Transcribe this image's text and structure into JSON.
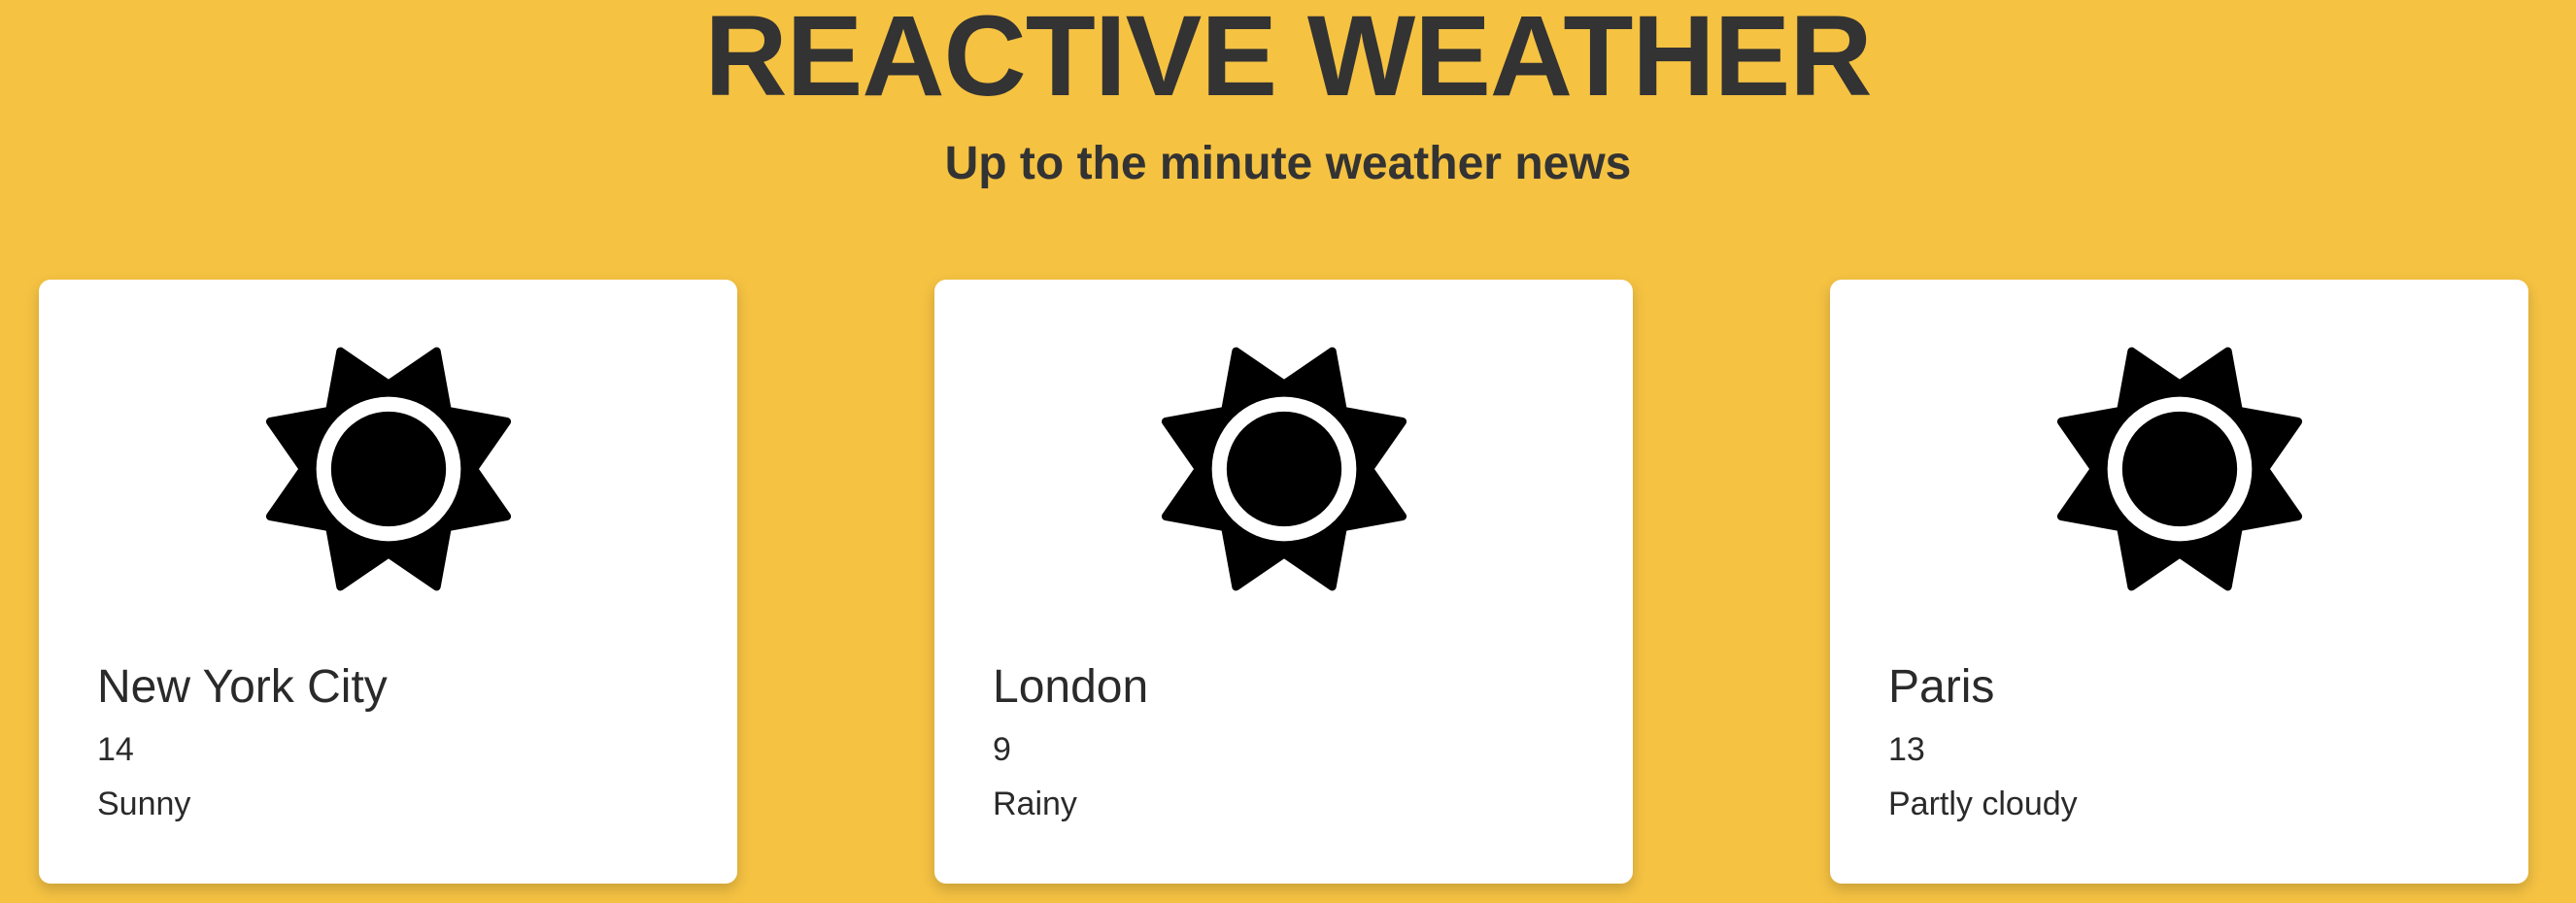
{
  "header": {
    "title": "REACTIVE WEATHER",
    "subtitle": "Up to the minute weather news"
  },
  "colors": {
    "background": "#F5C242",
    "card": "#FFFFFF",
    "text": "#333333"
  },
  "cities": [
    {
      "name": "New York City",
      "temperature": "14",
      "condition": "Sunny",
      "icon": "sun-icon"
    },
    {
      "name": "London",
      "temperature": "9",
      "condition": "Rainy",
      "icon": "sun-icon"
    },
    {
      "name": "Paris",
      "temperature": "13",
      "condition": "Partly cloudy",
      "icon": "sun-icon"
    }
  ]
}
